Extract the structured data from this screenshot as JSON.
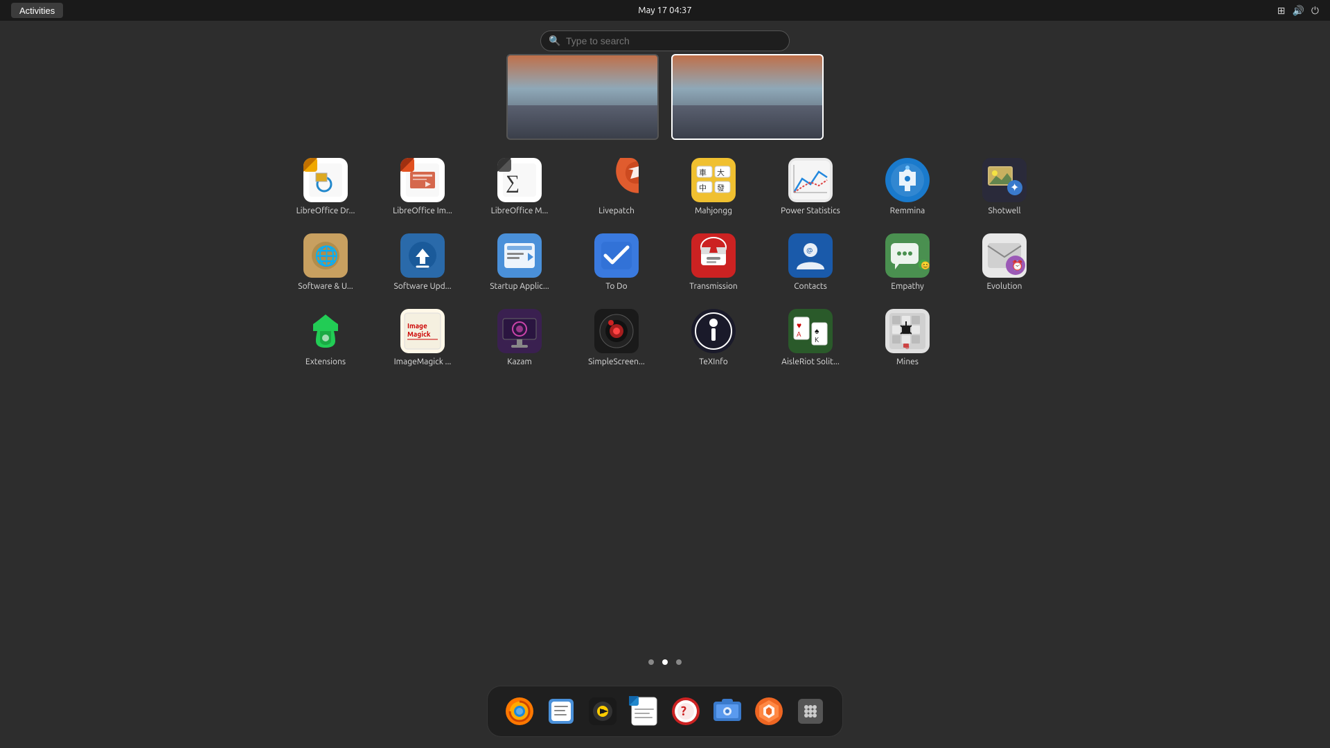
{
  "topbar": {
    "activities_label": "Activities",
    "clock": "May 17  04:37"
  },
  "search": {
    "placeholder": "Type to search"
  },
  "workspaces": [
    {
      "id": "ws1",
      "active": false
    },
    {
      "id": "ws2",
      "active": true
    }
  ],
  "apps": [
    {
      "id": "lodraw",
      "label": "LibreOffice Dr...",
      "icon_type": "lodraw"
    },
    {
      "id": "loimpress",
      "label": "LibreOffice Im...",
      "icon_type": "loimpress"
    },
    {
      "id": "lomath",
      "label": "LibreOffice M...",
      "icon_type": "lomath"
    },
    {
      "id": "livepatch",
      "label": "Livepatch",
      "icon_type": "livepatch"
    },
    {
      "id": "mahjongg",
      "label": "Mahjongg",
      "icon_type": "mahjongg"
    },
    {
      "id": "powerstats",
      "label": "Power Statistics",
      "icon_type": "powerstats"
    },
    {
      "id": "remmina",
      "label": "Remmina",
      "icon_type": "remmina"
    },
    {
      "id": "shotwell",
      "label": "Shotwell",
      "icon_type": "shotwell"
    },
    {
      "id": "softwareu",
      "label": "Software & U...",
      "icon_type": "softwareupdate"
    },
    {
      "id": "softwareupdater",
      "label": "Software Upd...",
      "icon_type": "softwareupdater"
    },
    {
      "id": "startup",
      "label": "Startup Applic...",
      "icon_type": "startup"
    },
    {
      "id": "todo",
      "label": "To Do",
      "icon_type": "todo"
    },
    {
      "id": "transmission",
      "label": "Transmission",
      "icon_type": "transmission"
    },
    {
      "id": "contacts",
      "label": "Contacts",
      "icon_type": "contacts"
    },
    {
      "id": "empathy",
      "label": "Empathy",
      "icon_type": "empathy"
    },
    {
      "id": "evolution",
      "label": "Evolution",
      "icon_type": "evolution"
    },
    {
      "id": "extensions",
      "label": "Extensions",
      "icon_type": "extensions"
    },
    {
      "id": "imagemagick",
      "label": "ImageMagick ...",
      "icon_type": "imagemagick"
    },
    {
      "id": "kazam",
      "label": "Kazam",
      "icon_type": "kazam"
    },
    {
      "id": "simplescreenrecorder",
      "label": "SimpleScreen...",
      "icon_type": "simplescreenrecorder"
    },
    {
      "id": "texinfo",
      "label": "TeXInfo",
      "icon_type": "texinfo"
    },
    {
      "id": "aisleriot",
      "label": "AisleRiot Solit...",
      "icon_type": "aisleriot"
    },
    {
      "id": "mines",
      "label": "Mines",
      "icon_type": "mines"
    }
  ],
  "dots": [
    {
      "id": "dot1",
      "active": false
    },
    {
      "id": "dot2",
      "active": true
    },
    {
      "id": "dot3",
      "active": false
    }
  ],
  "dock": [
    {
      "id": "firefox",
      "label": "Firefox"
    },
    {
      "id": "notes",
      "label": "Notes"
    },
    {
      "id": "rhythmbox",
      "label": "Rhythmbox"
    },
    {
      "id": "writer",
      "label": "LibreOffice Writer"
    },
    {
      "id": "help",
      "label": "Help"
    },
    {
      "id": "screenshot",
      "label": "Screenshot"
    },
    {
      "id": "brave",
      "label": "Brave Browser"
    },
    {
      "id": "appgrid",
      "label": "Show Applications"
    }
  ]
}
